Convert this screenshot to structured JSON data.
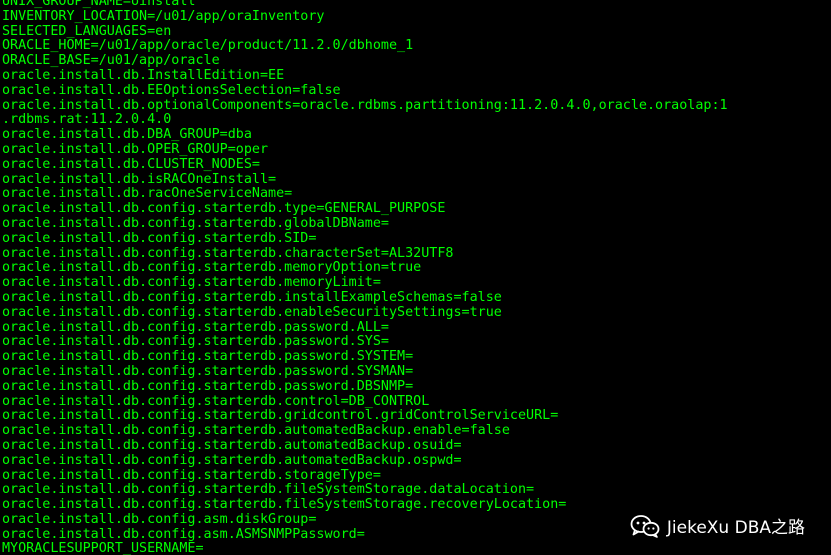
{
  "terminal": {
    "colors": {
      "background": "#000000",
      "text": "#00ff00"
    },
    "lines": [
      "UNIX_GROUP_NAME=oinstall",
      "INVENTORY_LOCATION=/u01/app/oraInventory",
      "SELECTED_LANGUAGES=en",
      "ORACLE_HOME=/u01/app/oracle/product/11.2.0/dbhome_1",
      "ORACLE_BASE=/u01/app/oracle",
      "oracle.install.db.InstallEdition=EE",
      "oracle.install.db.EEOptionsSelection=false",
      "oracle.install.db.optionalComponents=oracle.rdbms.partitioning:11.2.0.4.0,oracle.oraolap:1",
      ".rdbms.rat:11.2.0.4.0",
      "oracle.install.db.DBA_GROUP=dba",
      "oracle.install.db.OPER_GROUP=oper",
      "oracle.install.db.CLUSTER_NODES=",
      "oracle.install.db.isRACOneInstall=",
      "oracle.install.db.racOneServiceName=",
      "oracle.install.db.config.starterdb.type=GENERAL_PURPOSE",
      "oracle.install.db.config.starterdb.globalDBName=",
      "oracle.install.db.config.starterdb.SID=",
      "oracle.install.db.config.starterdb.characterSet=AL32UTF8",
      "oracle.install.db.config.starterdb.memoryOption=true",
      "oracle.install.db.config.starterdb.memoryLimit=",
      "oracle.install.db.config.starterdb.installExampleSchemas=false",
      "oracle.install.db.config.starterdb.enableSecuritySettings=true",
      "oracle.install.db.config.starterdb.password.ALL=",
      "oracle.install.db.config.starterdb.password.SYS=",
      "oracle.install.db.config.starterdb.password.SYSTEM=",
      "oracle.install.db.config.starterdb.password.SYSMAN=",
      "oracle.install.db.config.starterdb.password.DBSNMP=",
      "oracle.install.db.config.starterdb.control=DB_CONTROL",
      "oracle.install.db.config.starterdb.gridcontrol.gridControlServiceURL=",
      "oracle.install.db.config.starterdb.automatedBackup.enable=false",
      "oracle.install.db.config.starterdb.automatedBackup.osuid=",
      "oracle.install.db.config.starterdb.automatedBackup.ospwd=",
      "oracle.install.db.config.starterdb.storageType=",
      "oracle.install.db.config.starterdb.fileSystemStorage.dataLocation=",
      "oracle.install.db.config.starterdb.fileSystemStorage.recoveryLocation=",
      "oracle.install.db.config.asm.diskGroup=",
      "oracle.install.db.config.asm.ASMSNMPPassword=",
      "MYORACLESUPPORT_USERNAME="
    ]
  },
  "watermark": {
    "text": "JiekeXu DBA之路",
    "icon": "wechat-icon",
    "color": "#ffffff"
  }
}
